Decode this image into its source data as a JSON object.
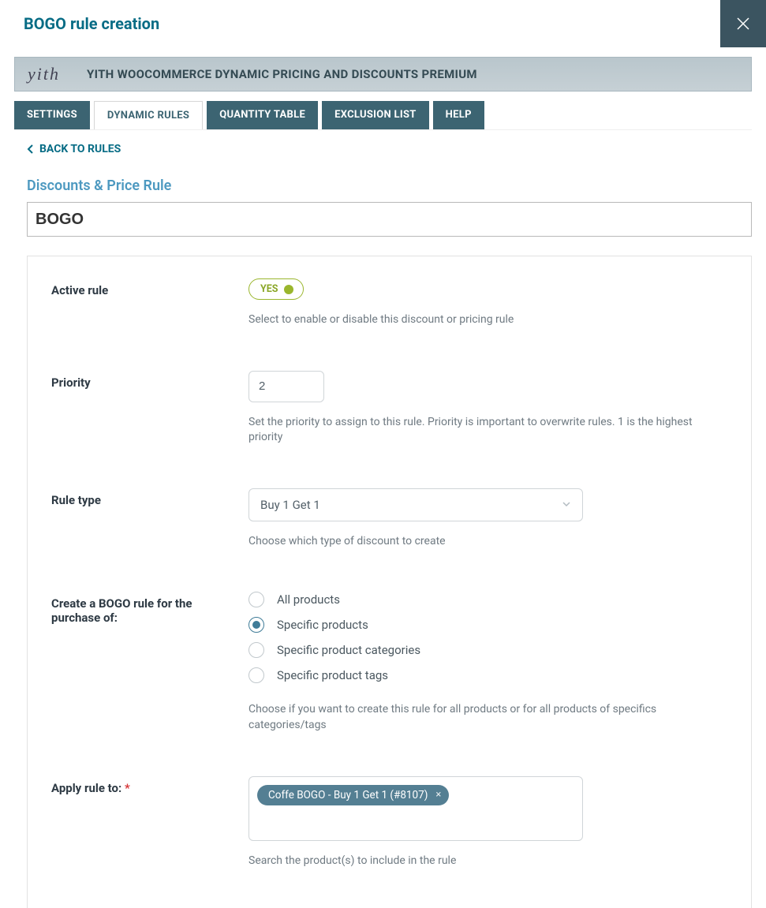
{
  "modal": {
    "title": "BOGO rule creation"
  },
  "plugin": {
    "name": "YITH WOOCOMMERCE DYNAMIC PRICING AND DISCOUNTS PREMIUM"
  },
  "tabs": {
    "settings": "SETTINGS",
    "dynamic_rules": "DYNAMIC RULES",
    "quantity_table": "QUANTITY TABLE",
    "exclusion_list": "EXCLUSION LIST",
    "help": "HELP"
  },
  "back_link": "BACK TO RULES",
  "section_title": "Discounts & Price Rule",
  "rule_name": "BOGO",
  "fields": {
    "active": {
      "label": "Active rule",
      "value_text": "YES",
      "help": "Select to enable or disable this discount or pricing rule"
    },
    "priority": {
      "label": "Priority",
      "value": "2",
      "help": "Set the priority to assign to this rule. Priority is important to overwrite rules. 1 is the highest priority"
    },
    "rule_type": {
      "label": "Rule type",
      "value": "Buy 1 Get 1",
      "help": "Choose which type of discount to create"
    },
    "bogo_for": {
      "label": "Create a BOGO rule for the purchase of:",
      "options": {
        "all": "All products",
        "specific_products": "Specific products",
        "specific_categories": "Specific product categories",
        "specific_tags": "Specific product tags"
      },
      "help": "Choose if you want to create this rule for all products or for all products of specifics categories/tags"
    },
    "apply_to": {
      "label": "Apply rule to:",
      "required_marker": "*",
      "chip": "Coffe BOGO - Buy 1 Get 1 (#8107)",
      "help": "Search the product(s) to include in the rule"
    }
  }
}
